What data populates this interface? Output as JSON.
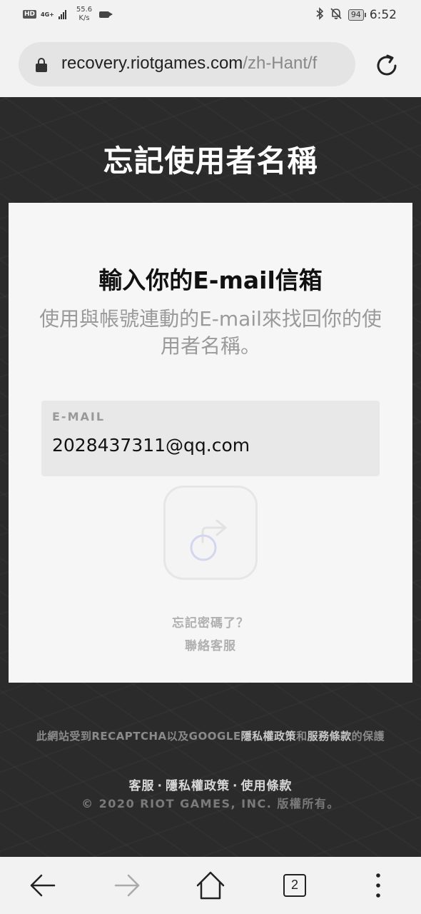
{
  "status_bar": {
    "hd": "HD",
    "network": "4G+",
    "speed_value": "55.6",
    "speed_unit": "K/s",
    "battery": "94",
    "time": "6:52",
    "icons": [
      "hd-icon",
      "signal-icon",
      "video-icon",
      "bluetooth-icon",
      "mute-icon",
      "battery-icon"
    ]
  },
  "browser": {
    "url_host": "recovery.riotgames.com",
    "url_path": "/zh-Hant/f",
    "tab_count": "2"
  },
  "page": {
    "title": "忘記使用者名稱",
    "heading": "輸入你的E-mail信箱",
    "subheading": "使用與帳號連動的E-mail來找回你的使用者名稱。",
    "email_label": "E-MAIL",
    "email_value": "2028437311@qq.com",
    "forgot_password": "忘記密碼了？",
    "contact_support": "聯絡客服"
  },
  "recaptcha": {
    "prefix": "此網站受到RECAPTCHA以及GOOGLE",
    "privacy": "隱私權政策",
    "and": "和",
    "terms": "服務條款",
    "suffix": "的保護"
  },
  "footer": {
    "support": "客服",
    "privacy": "隱私權政策",
    "terms": "使用條款",
    "separator": "·",
    "copyright": "© 2020 RIOT GAMES, INC. 版權所有。"
  },
  "colors": {
    "page_background": "#2b2b2b",
    "card_background": "#f6f6f6",
    "input_background": "#e8e8e8",
    "muted_text": "#9a9a9a"
  }
}
